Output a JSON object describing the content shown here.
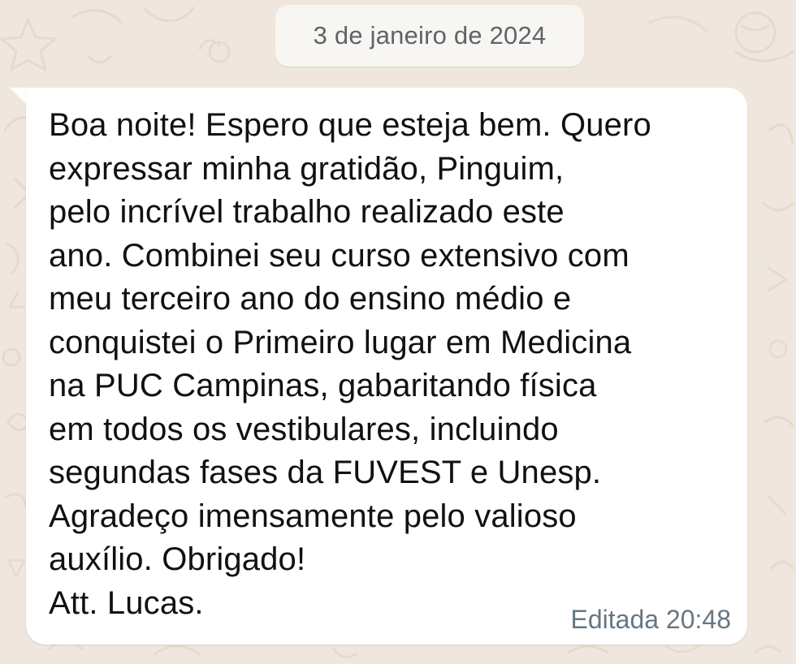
{
  "conversation": {
    "date_separator": "3 de janeiro de 2024",
    "message": {
      "text": "Boa noite! Espero que esteja bem. Quero\nexpressar minha gratidão, Pinguim,\npelo incrível trabalho realizado este\nano. Combinei seu curso extensivo com\nmeu terceiro ano do ensino médio e\nconquistei o Primeiro lugar em Medicina\nna PUC Campinas, gabaritando física\nem todos os vestibulares, incluindo\nsegundas fases da FUVEST e Unesp.\nAgradeço imensamente pelo valioso\nauxílio. Obrigado!\nAtt. Lucas.",
      "status": "Editada",
      "time": "20:48"
    }
  },
  "theme": {
    "background": "#efe7dd",
    "bubble": "#ffffff",
    "date_chip": "#f8f6f3",
    "meta_text": "#667781"
  }
}
